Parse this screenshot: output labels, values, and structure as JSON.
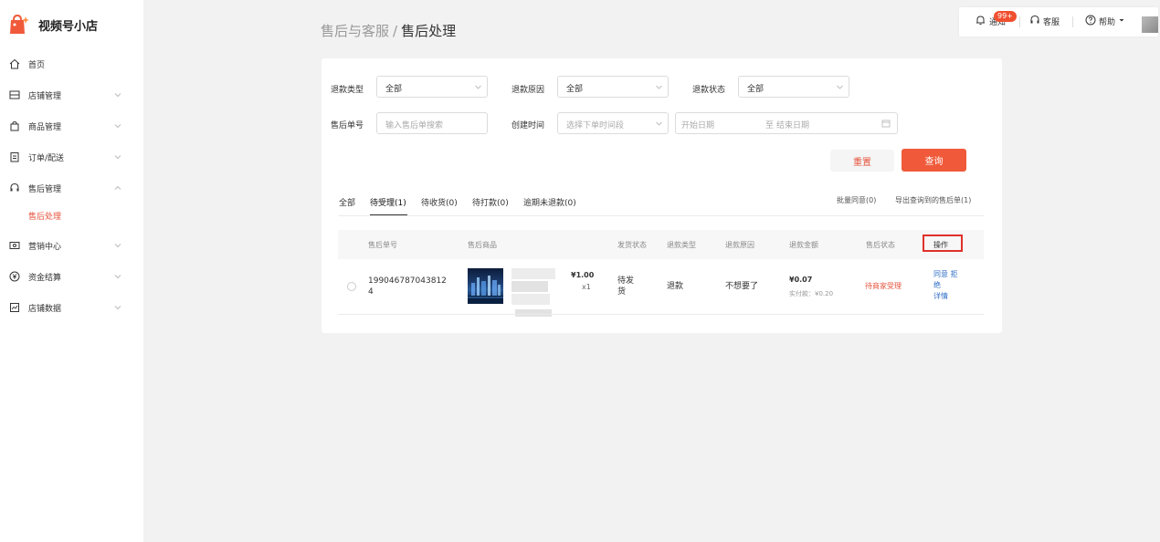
{
  "brand": {
    "name": "视频号小店"
  },
  "sidebar": {
    "items": [
      {
        "label": "首页",
        "icon": "home-icon"
      },
      {
        "label": "店铺管理",
        "icon": "store-icon"
      },
      {
        "label": "商品管理",
        "icon": "bag-icon"
      },
      {
        "label": "订单/配送",
        "icon": "clipboard-icon"
      },
      {
        "label": "售后管理",
        "icon": "headset-icon"
      },
      {
        "label": "营销中心",
        "icon": "coupon-icon"
      },
      {
        "label": "资金结算",
        "icon": "yen-icon"
      },
      {
        "label": "店铺数据",
        "icon": "chart-icon"
      }
    ],
    "sub_item": "售后处理"
  },
  "topbar": {
    "notice_label": "通知",
    "notice_badge": "99+",
    "service_label": "客服",
    "help_label": "帮助"
  },
  "breadcrumb": {
    "parent": "售后与客服",
    "separator": "/",
    "current": "售后处理"
  },
  "filters": {
    "refund_type_label": "退款类型",
    "refund_type_value": "全部",
    "refund_reason_label": "退款原因",
    "refund_reason_value": "全部",
    "refund_status_label": "退款状态",
    "refund_status_value": "全部",
    "aftersale_no_label": "售后单号",
    "aftersale_no_placeholder": "输入售后单搜索",
    "created_time_label": "创建时间",
    "created_time_placeholder": "选择下单时间段",
    "start_date_placeholder": "开始日期",
    "range_separator": "至",
    "end_date_placeholder": "结束日期",
    "reset_label": "重置",
    "query_label": "查询"
  },
  "tabs": [
    {
      "label": "全部"
    },
    {
      "label": "待受理(1)"
    },
    {
      "label": "待收货(0)"
    },
    {
      "label": "待打款(0)"
    },
    {
      "label": "逾期未退款(0)"
    }
  ],
  "actions": {
    "batch_agree": "批量同意(0)",
    "export": "导出查询到的售后单(1)"
  },
  "table": {
    "headers": [
      "售后单号",
      "售后商品",
      "发货状态",
      "退款类型",
      "退款原因",
      "退款金额",
      "售后状态",
      "操作"
    ],
    "row": {
      "order_no_line1": "199046787043812",
      "order_no_line2": "4",
      "price": "¥1.00",
      "qty": "x1",
      "ship_status_line1": "待发",
      "ship_status_line2": "货",
      "refund_type": "退款",
      "refund_reason": "不想要了",
      "refund_amount": "¥0.07",
      "paid_amount": "实付款：¥0.20",
      "status": "待商家受理",
      "op_agree": "同意",
      "op_reject_1": "拒",
      "op_reject_2": "绝",
      "op_detail": "详情"
    }
  },
  "colors": {
    "accent": "#f05a3a",
    "danger_text": "#e5533d",
    "link": "#2f6fc6",
    "highlight_border": "#e0302a"
  }
}
